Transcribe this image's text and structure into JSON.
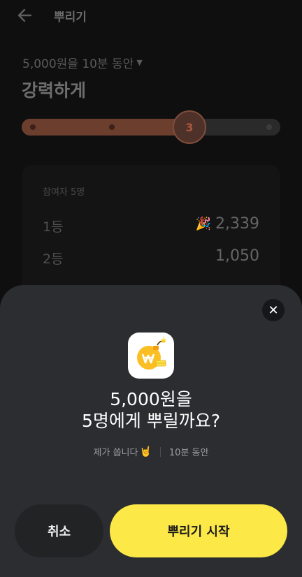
{
  "header": {
    "title": "뿌리기",
    "back_icon": "arrow-left-icon"
  },
  "settings": {
    "amount_time": "5,000원을 10분 동안",
    "caret_icon": "caret-down-icon",
    "intensity": "강력하게"
  },
  "slider": {
    "value": "3",
    "level": 3,
    "max": 5,
    "fill_color": "#6b3e2e"
  },
  "result": {
    "participants": "참여자 5명",
    "ranks": [
      {
        "rank": "1등",
        "amount": "2,339",
        "emoji": "🎉"
      },
      {
        "rank": "2등",
        "amount": "1,050",
        "emoji": ""
      }
    ]
  },
  "sheet": {
    "close_icon": "close-icon",
    "app_icon": "coin-bomb-icon",
    "title_line1": "5,000원을",
    "title_line2": "5명에게 뿌릴까요?",
    "meta_left": "제가 쏩니다",
    "meta_right": "10분 동안",
    "cancel_label": "취소",
    "start_label": "뿌리기 시작",
    "accent_color": "#fce847"
  }
}
